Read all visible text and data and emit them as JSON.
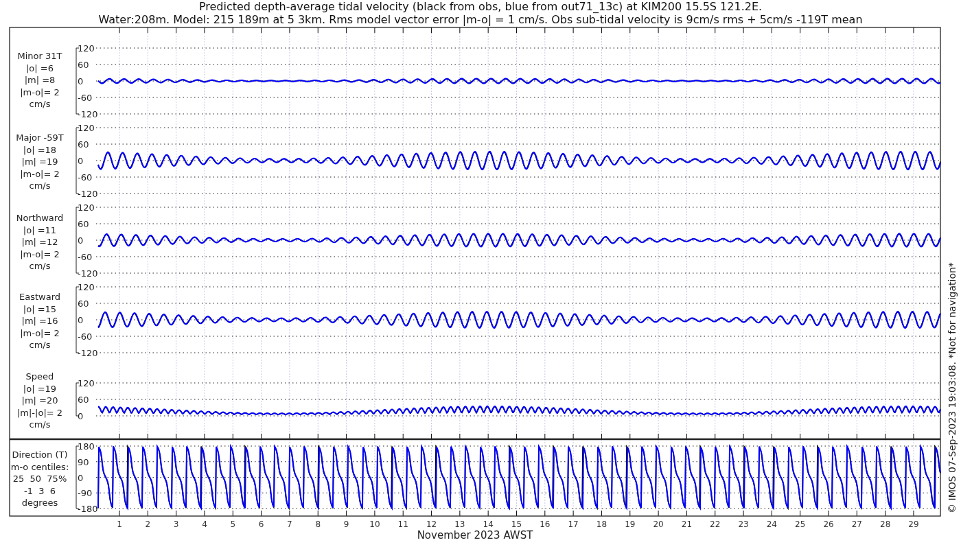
{
  "title_lines": [
    "Predicted depth-average tidal velocity (black from obs, blue from out71_13c) at KIM200 15.5S 121.2E.",
    "Water:208m. Model: 215 189m at 5 3km. Rms model vector error |m-o| = 1 cm/s. Obs sub-tidal velocity is 9cm/s rms + 5cm/s -119T mean"
  ],
  "panels": [
    {
      "kind": "velocity",
      "label_lines": [
        "Minor 31T",
        "|o| =6",
        "|m| =8",
        "|m-o|= 2",
        "cm/s"
      ],
      "yticks": [
        "120",
        "60",
        "0",
        "-60",
        "-120"
      ]
    },
    {
      "kind": "velocity",
      "label_lines": [
        "Major -59T",
        "|o| =18",
        "|m| =19",
        "|m-o|= 2",
        "cm/s"
      ],
      "yticks": [
        "120",
        "60",
        "0",
        "-60",
        "-120"
      ]
    },
    {
      "kind": "velocity",
      "label_lines": [
        "Northward",
        "|o| =11",
        "|m| =12",
        "|m-o|= 2",
        "cm/s"
      ],
      "yticks": [
        "120",
        "60",
        "0",
        "-60",
        "-120"
      ]
    },
    {
      "kind": "velocity",
      "label_lines": [
        "Eastward",
        "|o| =15",
        "|m| =16",
        "|m-o|= 2",
        "cm/s"
      ],
      "yticks": [
        "120",
        "60",
        "0",
        "-60",
        "-120"
      ]
    },
    {
      "kind": "speed",
      "label_lines": [
        "Speed",
        "|o| =19",
        "|m| =20",
        "|m|-|o|= 2",
        "cm/s"
      ],
      "yticks": [
        "120",
        "60",
        "0"
      ]
    },
    {
      "kind": "direction",
      "label_lines": [
        "Direction (T)",
        "m-o centiles:",
        "25  50  75%",
        "-1  3  6",
        "degrees"
      ],
      "yticks": [
        "180",
        "90",
        "0",
        "-90",
        "-180"
      ]
    }
  ],
  "xticks": [
    "1",
    "2",
    "3",
    "4",
    "5",
    "6",
    "7",
    "8",
    "9",
    "10",
    "11",
    "12",
    "13",
    "14",
    "15",
    "16",
    "17",
    "18",
    "19",
    "20",
    "21",
    "22",
    "23",
    "24",
    "25",
    "26",
    "27",
    "28",
    "29"
  ],
  "xlabel": "November 2023 AWST",
  "side_note": "© IMOS 07-Sep-2023 19:03:08. *Not for navigation*"
}
